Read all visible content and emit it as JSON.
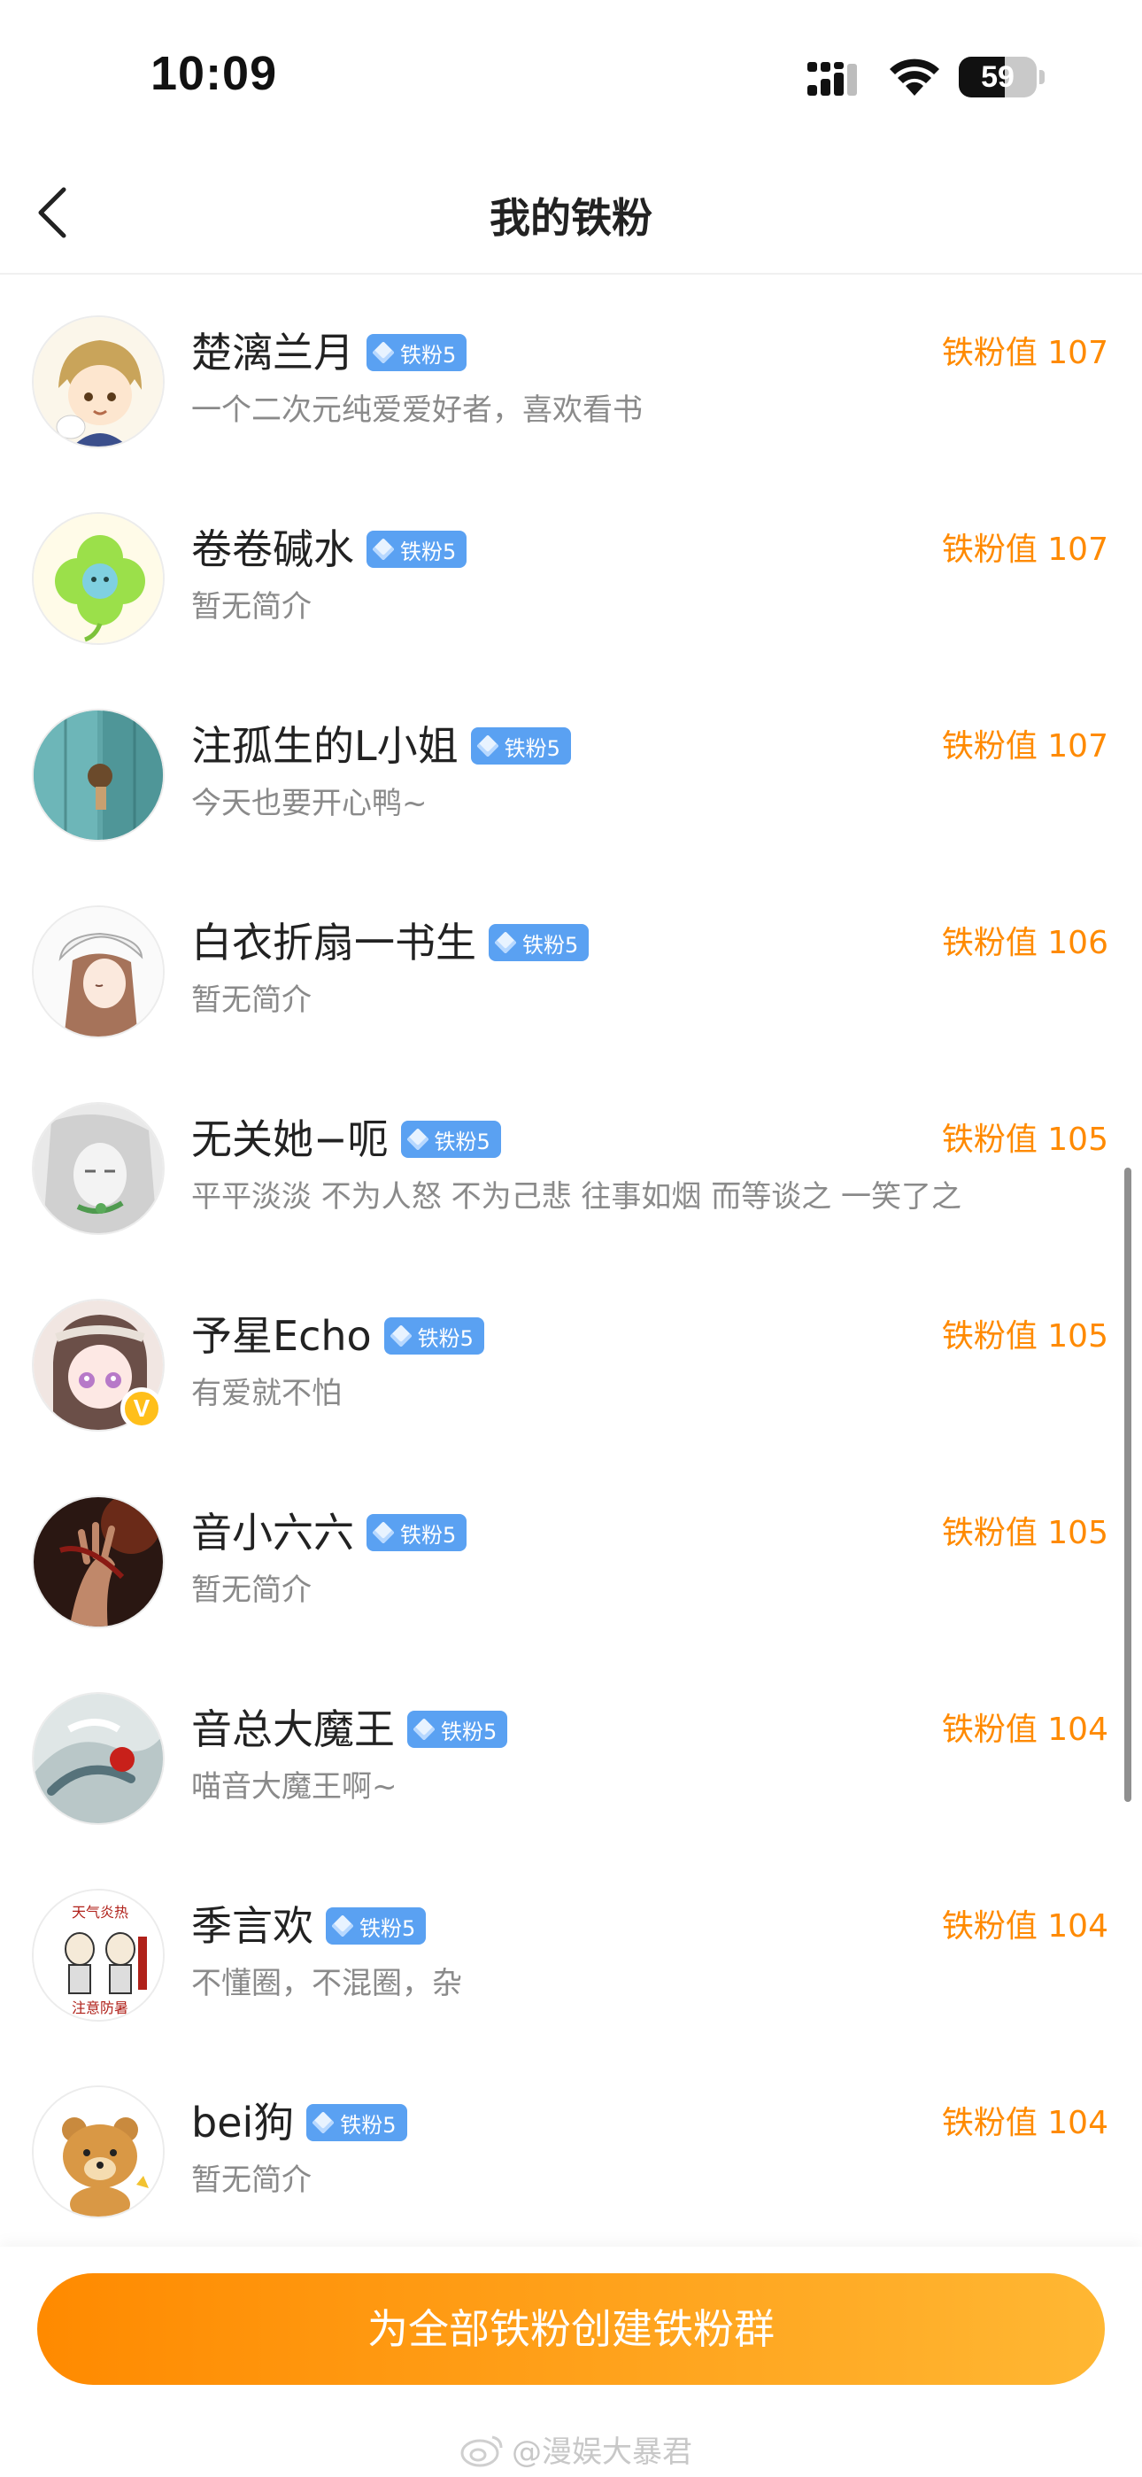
{
  "status_bar": {
    "time": "10:09",
    "battery": "59",
    "battery_level": 0.59
  },
  "nav": {
    "title": "我的铁粉"
  },
  "fans": [
    {
      "name": "楚漓兰月",
      "badge": "铁粉5",
      "bio": "一个二次元纯爱爱好者，喜欢看书",
      "value": "铁粉值 107",
      "avatar_icon": "anime-boy-avatar",
      "verified": false
    },
    {
      "name": "卷卷碱水",
      "badge": "铁粉5",
      "bio": "暂无简介",
      "value": "铁粉值 107",
      "avatar_icon": "clover-avatar",
      "verified": false
    },
    {
      "name": "注孤生的L小姐",
      "badge": "铁粉5",
      "bio": "今天也要开心鸭~",
      "value": "铁粉值 107",
      "avatar_icon": "teal-door-avatar",
      "verified": false
    },
    {
      "name": "白衣折扇一书生",
      "badge": "铁粉5",
      "bio": "暂无简介",
      "value": "铁粉值 106",
      "avatar_icon": "sketch-girl-avatar",
      "verified": false
    },
    {
      "name": "无关她−呃",
      "badge": "铁粉5",
      "bio": "平平淡淡 不为人怒 不为己悲 往事如烟 而等谈之 一笑了之",
      "value": "铁粉值 105",
      "avatar_icon": "grey-sketch-avatar",
      "verified": false
    },
    {
      "name": "予星Echo",
      "badge": "铁粉5",
      "bio": "有爱就不怕",
      "value": "铁粉值 105",
      "avatar_icon": "anime-girl-avatar",
      "verified": true,
      "verified_mark": "V"
    },
    {
      "name": "音小六六",
      "badge": "铁粉5",
      "bio": "暂无简介",
      "value": "铁粉值 105",
      "avatar_icon": "dark-hands-avatar",
      "verified": false
    },
    {
      "name": "音总大魔王",
      "badge": "铁粉5",
      "bio": "喵音大魔王啊~",
      "value": "铁粉值 104",
      "avatar_icon": "ink-painting-avatar",
      "verified": false
    },
    {
      "name": "季言欢",
      "badge": "铁粉5",
      "bio": "不懂圈，不混圈，杂",
      "value": "铁粉值 104",
      "avatar_icon": "summer-heat-avatar",
      "verified": false,
      "avatar_text_top": "天气炎热",
      "avatar_text_bottom": "注意防暑"
    },
    {
      "name": "bei狗",
      "badge": "铁粉5",
      "bio": "暂无简介",
      "value": "铁粉值 104",
      "avatar_icon": "bear-avatar",
      "verified": false
    }
  ],
  "bottom": {
    "button_label": "为全部铁粉创建铁粉群",
    "watermark": "@漫娱大暴君"
  },
  "colors": {
    "accent": "#ff8a00",
    "badge_blue": "#5aa1f2",
    "text_primary": "#222222",
    "text_secondary": "#8a8a8a"
  }
}
